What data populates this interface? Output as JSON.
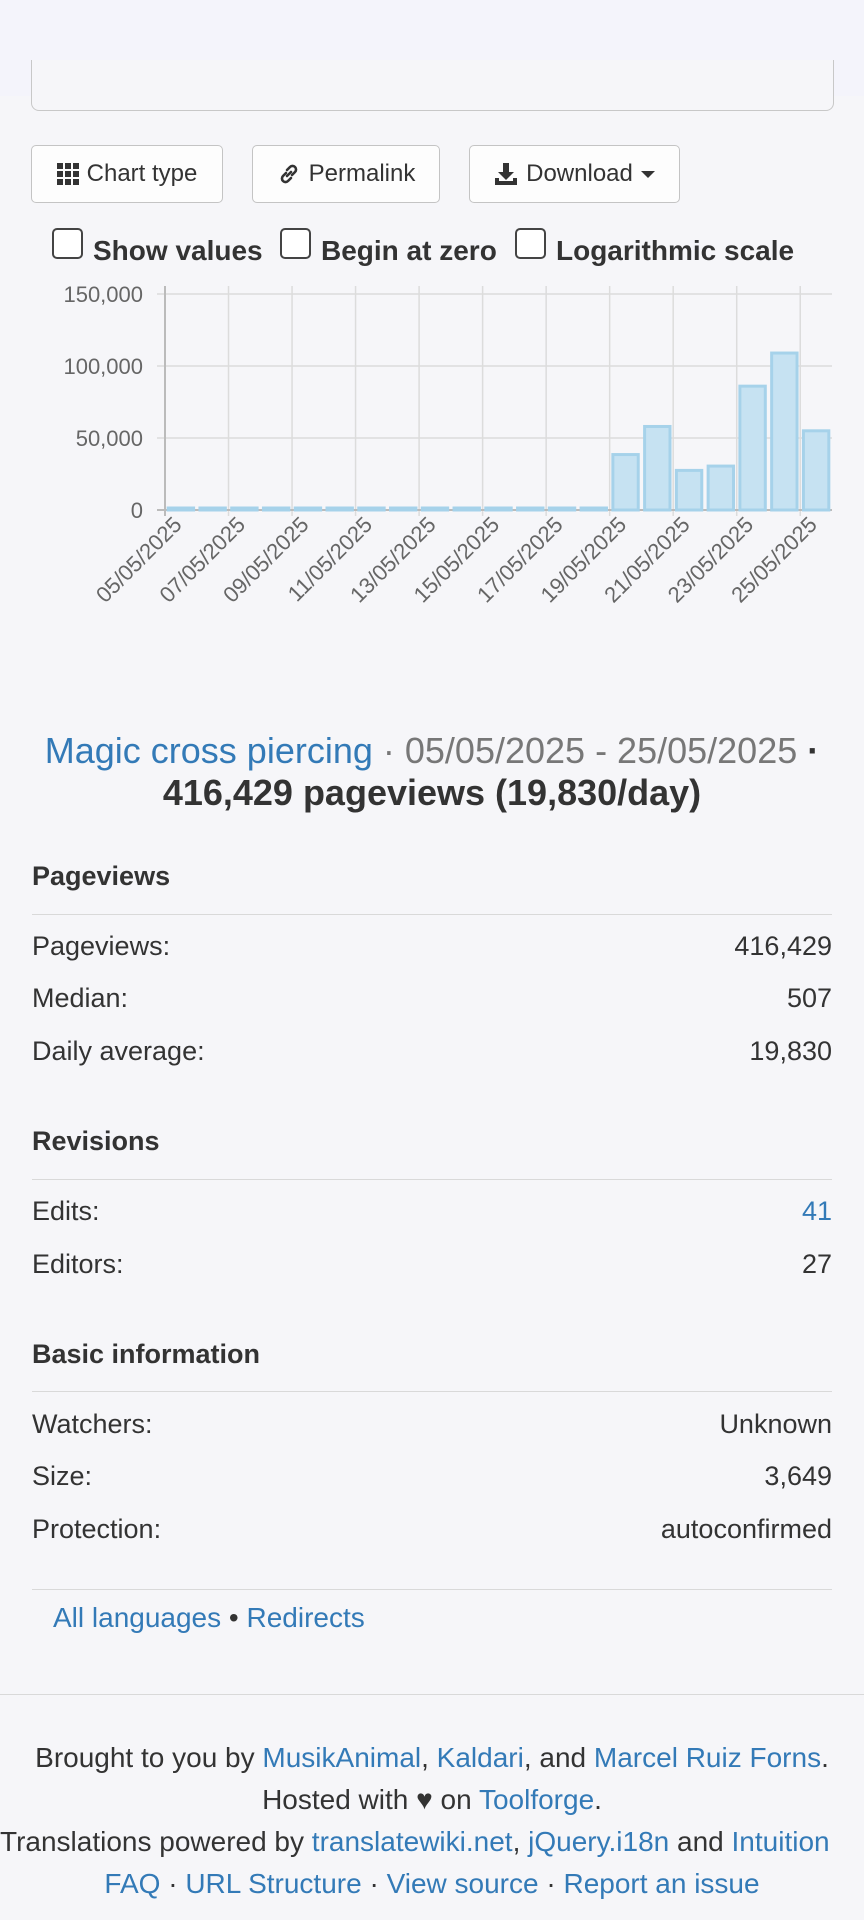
{
  "toolbar": {
    "chart_type_label": "Chart type",
    "permalink_label": "Permalink",
    "download_label": "Download"
  },
  "options": {
    "show_values": "Show values",
    "begin_at_zero": "Begin at zero",
    "log_scale": "Logarithmic scale"
  },
  "chart_data": {
    "type": "bar",
    "categories": [
      "05/05/2025",
      "06/05/2025",
      "07/05/2025",
      "08/05/2025",
      "09/05/2025",
      "10/05/2025",
      "11/05/2025",
      "12/05/2025",
      "13/05/2025",
      "14/05/2025",
      "15/05/2025",
      "16/05/2025",
      "17/05/2025",
      "18/05/2025",
      "19/05/2025",
      "20/05/2025",
      "21/05/2025",
      "22/05/2025",
      "23/05/2025",
      "24/05/2025",
      "25/05/2025"
    ],
    "tick_labels": [
      "05/05/2025",
      "07/05/2025",
      "09/05/2025",
      "11/05/2025",
      "13/05/2025",
      "15/05/2025",
      "17/05/2025",
      "19/05/2025",
      "21/05/2025",
      "23/05/2025",
      "25/05/2025"
    ],
    "values": [
      507,
      480,
      460,
      470,
      500,
      490,
      510,
      480,
      470,
      495,
      505,
      520,
      500,
      507,
      38500,
      58000,
      27500,
      30500,
      86000,
      109000,
      55000
    ],
    "yticks": [
      "0",
      "50,000",
      "100,000",
      "150,000"
    ],
    "ylim": [
      0,
      150000
    ],
    "grid": true,
    "color": "#c6e2f2",
    "stroke": "#a6d2ea"
  },
  "summary": {
    "article": "Magic cross piercing",
    "sep1": " · ",
    "date_range": "05/05/2025 - 25/05/2025",
    "sep2": " · ",
    "totals": "416,429 pageviews (19,830/day)"
  },
  "pageviews_section": {
    "heading": "Pageviews",
    "rows": [
      {
        "label": "Pageviews:",
        "value": "416,429"
      },
      {
        "label": "Median:",
        "value": "507"
      },
      {
        "label": "Daily average:",
        "value": "19,830"
      }
    ]
  },
  "revisions_section": {
    "heading": "Revisions",
    "rows": [
      {
        "label": "Edits:",
        "value": "41"
      },
      {
        "label": "Editors:",
        "value": "27"
      }
    ]
  },
  "basic_section": {
    "heading": "Basic information",
    "rows": [
      {
        "label": "Watchers:",
        "value": "Unknown"
      },
      {
        "label": "Size:",
        "value": "3,649"
      },
      {
        "label": "Protection:",
        "value": "autoconfirmed"
      }
    ]
  },
  "links": {
    "all_languages": "All languages",
    "bullet": "•",
    "redirects": "Redirects"
  },
  "footer": {
    "brought_prefix": "Brought to you by ",
    "author1": "MusikAnimal",
    "comma": ",",
    "author2": "Kaldari",
    "and": ", and ",
    "author3": "Marcel Ruiz Forns",
    "period": ".",
    "hosted_prefix": "Hosted with ♥ on ",
    "toolforge": "Toolforge",
    "translations_prefix": "Translations powered by ",
    "translatewiki": "translatewiki.net",
    "jquery": "jQuery.i18n",
    "and2": " and ",
    "intuition": "Intuition",
    "faq": "FAQ",
    "dot": " · ",
    "url_structure": "URL Structure",
    "view_source": "View source",
    "report_issue": "Report an issue"
  }
}
